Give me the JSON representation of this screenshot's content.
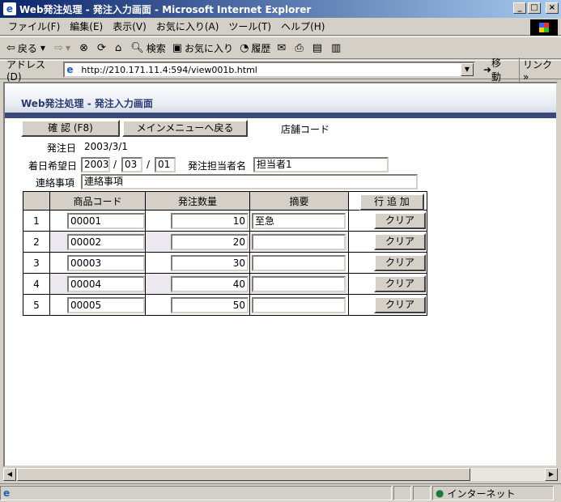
{
  "window": {
    "title": "Web発注処理 - 発注入力画面 - Microsoft Internet Explorer",
    "minimize": "_",
    "maximize": "□",
    "close": "×"
  },
  "menubar": {
    "items": [
      "ファイル(F)",
      "編集(E)",
      "表示(V)",
      "お気に入り(A)",
      "ツール(T)",
      "ヘルプ(H)"
    ]
  },
  "toolbar": {
    "back": "戻る",
    "search": "検索",
    "favorites": "お気に入り",
    "history": "履歴"
  },
  "addressbar": {
    "label": "アドレス(D)",
    "url": "http://210.171.11.4:594/view001b.html",
    "go": "移動",
    "links": "リンク »"
  },
  "page": {
    "banner_title": "Web発注処理 - 発注入力画面",
    "confirm_button": "確 認 (F8)",
    "main_menu_button": "メインメニューへ戻る",
    "store_code_label": "店舗コード",
    "order_date_label": "発注日",
    "order_date_value": "2003/3/1",
    "desired_date_label": "着日希望日",
    "desired_year": "2003",
    "desired_month": "03",
    "desired_day": "01",
    "date_sep": "/",
    "person_label": "発注担当者名",
    "person_value": "担当者1",
    "notes_label": "連絡事項",
    "notes_value": "連絡事項"
  },
  "table": {
    "headers": [
      "",
      "商品コード",
      "発注数量",
      "摘要"
    ],
    "add_row_button": "行 追 加",
    "clear_label": "クリア",
    "rows": [
      {
        "num": "1",
        "code": "00001",
        "qty": "10",
        "memo": "至急"
      },
      {
        "num": "2",
        "code": "00002",
        "qty": "20",
        "memo": ""
      },
      {
        "num": "3",
        "code": "00003",
        "qty": "30",
        "memo": ""
      },
      {
        "num": "4",
        "code": "00004",
        "qty": "40",
        "memo": ""
      },
      {
        "num": "5",
        "code": "00005",
        "qty": "50",
        "memo": ""
      }
    ]
  },
  "statusbar": {
    "zone": "インターネット"
  }
}
